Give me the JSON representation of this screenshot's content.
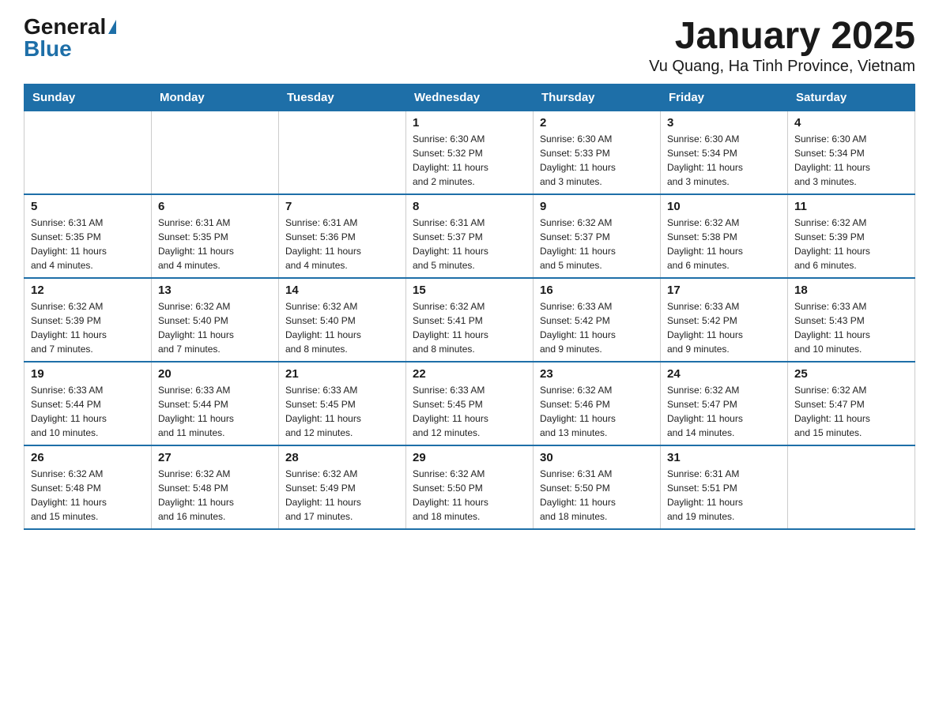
{
  "header": {
    "logo_general": "General",
    "logo_blue": "Blue",
    "title": "January 2025",
    "subtitle": "Vu Quang, Ha Tinh Province, Vietnam"
  },
  "days_of_week": [
    "Sunday",
    "Monday",
    "Tuesday",
    "Wednesday",
    "Thursday",
    "Friday",
    "Saturday"
  ],
  "weeks": [
    {
      "days": [
        {
          "num": "",
          "info": ""
        },
        {
          "num": "",
          "info": ""
        },
        {
          "num": "",
          "info": ""
        },
        {
          "num": "1",
          "info": "Sunrise: 6:30 AM\nSunset: 5:32 PM\nDaylight: 11 hours\nand 2 minutes."
        },
        {
          "num": "2",
          "info": "Sunrise: 6:30 AM\nSunset: 5:33 PM\nDaylight: 11 hours\nand 3 minutes."
        },
        {
          "num": "3",
          "info": "Sunrise: 6:30 AM\nSunset: 5:34 PM\nDaylight: 11 hours\nand 3 minutes."
        },
        {
          "num": "4",
          "info": "Sunrise: 6:30 AM\nSunset: 5:34 PM\nDaylight: 11 hours\nand 3 minutes."
        }
      ]
    },
    {
      "days": [
        {
          "num": "5",
          "info": "Sunrise: 6:31 AM\nSunset: 5:35 PM\nDaylight: 11 hours\nand 4 minutes."
        },
        {
          "num": "6",
          "info": "Sunrise: 6:31 AM\nSunset: 5:35 PM\nDaylight: 11 hours\nand 4 minutes."
        },
        {
          "num": "7",
          "info": "Sunrise: 6:31 AM\nSunset: 5:36 PM\nDaylight: 11 hours\nand 4 minutes."
        },
        {
          "num": "8",
          "info": "Sunrise: 6:31 AM\nSunset: 5:37 PM\nDaylight: 11 hours\nand 5 minutes."
        },
        {
          "num": "9",
          "info": "Sunrise: 6:32 AM\nSunset: 5:37 PM\nDaylight: 11 hours\nand 5 minutes."
        },
        {
          "num": "10",
          "info": "Sunrise: 6:32 AM\nSunset: 5:38 PM\nDaylight: 11 hours\nand 6 minutes."
        },
        {
          "num": "11",
          "info": "Sunrise: 6:32 AM\nSunset: 5:39 PM\nDaylight: 11 hours\nand 6 minutes."
        }
      ]
    },
    {
      "days": [
        {
          "num": "12",
          "info": "Sunrise: 6:32 AM\nSunset: 5:39 PM\nDaylight: 11 hours\nand 7 minutes."
        },
        {
          "num": "13",
          "info": "Sunrise: 6:32 AM\nSunset: 5:40 PM\nDaylight: 11 hours\nand 7 minutes."
        },
        {
          "num": "14",
          "info": "Sunrise: 6:32 AM\nSunset: 5:40 PM\nDaylight: 11 hours\nand 8 minutes."
        },
        {
          "num": "15",
          "info": "Sunrise: 6:32 AM\nSunset: 5:41 PM\nDaylight: 11 hours\nand 8 minutes."
        },
        {
          "num": "16",
          "info": "Sunrise: 6:33 AM\nSunset: 5:42 PM\nDaylight: 11 hours\nand 9 minutes."
        },
        {
          "num": "17",
          "info": "Sunrise: 6:33 AM\nSunset: 5:42 PM\nDaylight: 11 hours\nand 9 minutes."
        },
        {
          "num": "18",
          "info": "Sunrise: 6:33 AM\nSunset: 5:43 PM\nDaylight: 11 hours\nand 10 minutes."
        }
      ]
    },
    {
      "days": [
        {
          "num": "19",
          "info": "Sunrise: 6:33 AM\nSunset: 5:44 PM\nDaylight: 11 hours\nand 10 minutes."
        },
        {
          "num": "20",
          "info": "Sunrise: 6:33 AM\nSunset: 5:44 PM\nDaylight: 11 hours\nand 11 minutes."
        },
        {
          "num": "21",
          "info": "Sunrise: 6:33 AM\nSunset: 5:45 PM\nDaylight: 11 hours\nand 12 minutes."
        },
        {
          "num": "22",
          "info": "Sunrise: 6:33 AM\nSunset: 5:45 PM\nDaylight: 11 hours\nand 12 minutes."
        },
        {
          "num": "23",
          "info": "Sunrise: 6:32 AM\nSunset: 5:46 PM\nDaylight: 11 hours\nand 13 minutes."
        },
        {
          "num": "24",
          "info": "Sunrise: 6:32 AM\nSunset: 5:47 PM\nDaylight: 11 hours\nand 14 minutes."
        },
        {
          "num": "25",
          "info": "Sunrise: 6:32 AM\nSunset: 5:47 PM\nDaylight: 11 hours\nand 15 minutes."
        }
      ]
    },
    {
      "days": [
        {
          "num": "26",
          "info": "Sunrise: 6:32 AM\nSunset: 5:48 PM\nDaylight: 11 hours\nand 15 minutes."
        },
        {
          "num": "27",
          "info": "Sunrise: 6:32 AM\nSunset: 5:48 PM\nDaylight: 11 hours\nand 16 minutes."
        },
        {
          "num": "28",
          "info": "Sunrise: 6:32 AM\nSunset: 5:49 PM\nDaylight: 11 hours\nand 17 minutes."
        },
        {
          "num": "29",
          "info": "Sunrise: 6:32 AM\nSunset: 5:50 PM\nDaylight: 11 hours\nand 18 minutes."
        },
        {
          "num": "30",
          "info": "Sunrise: 6:31 AM\nSunset: 5:50 PM\nDaylight: 11 hours\nand 18 minutes."
        },
        {
          "num": "31",
          "info": "Sunrise: 6:31 AM\nSunset: 5:51 PM\nDaylight: 11 hours\nand 19 minutes."
        },
        {
          "num": "",
          "info": ""
        }
      ]
    }
  ]
}
